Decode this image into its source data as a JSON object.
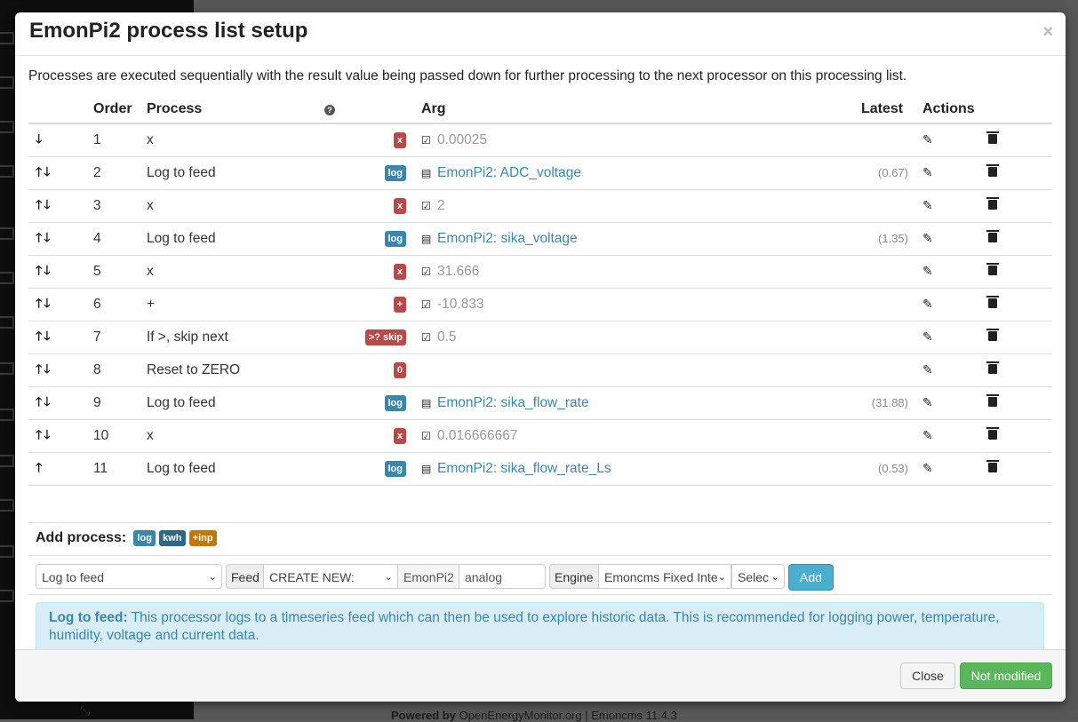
{
  "background": {
    "footer_powered": "Powered by",
    "footer_link": "OpenEnergyMonitor.org",
    "footer_version": "| Emoncms 11.4.3"
  },
  "modal": {
    "title": "EmonPi2 process list setup",
    "close_symbol": "×",
    "intro": "Processes are executed sequentially with the result value being passed down for further processing to the next processor on this processing list.",
    "table": {
      "headers": {
        "order": "Order",
        "process": "Process",
        "help": "?",
        "arg": "Arg",
        "latest": "Latest",
        "actions": "Actions"
      },
      "rows": [
        {
          "arrows": "down",
          "order": "1",
          "process": "x",
          "badge": "x",
          "badge_color": "#b94a48",
          "arg_type": "value",
          "arg": "0.00025",
          "latest": ""
        },
        {
          "arrows": "updown",
          "order": "2",
          "process": "Log to feed",
          "badge": "log",
          "badge_color": "#3a87ad",
          "arg_type": "feed",
          "arg": "EmonPi2: ADC_voltage",
          "latest": "(0.67)"
        },
        {
          "arrows": "updown",
          "order": "3",
          "process": "x",
          "badge": "x",
          "badge_color": "#b94a48",
          "arg_type": "value",
          "arg": "2",
          "latest": ""
        },
        {
          "arrows": "updown",
          "order": "4",
          "process": "Log to feed",
          "badge": "log",
          "badge_color": "#3a87ad",
          "arg_type": "feed",
          "arg": "EmonPi2: sika_voltage",
          "latest": "(1.35)"
        },
        {
          "arrows": "updown",
          "order": "5",
          "process": "x",
          "badge": "x",
          "badge_color": "#b94a48",
          "arg_type": "value",
          "arg": "31.666",
          "latest": ""
        },
        {
          "arrows": "updown",
          "order": "6",
          "process": "+",
          "badge": "+",
          "badge_color": "#b94a48",
          "arg_type": "value",
          "arg": "-10.833",
          "latest": ""
        },
        {
          "arrows": "updown",
          "order": "7",
          "process": "If >, skip next",
          "badge": ">? skip",
          "badge_color": "#b94a48",
          "arg_type": "value",
          "arg": "0.5",
          "latest": ""
        },
        {
          "arrows": "updown",
          "order": "8",
          "process": "Reset to ZERO",
          "badge": "0",
          "badge_color": "#b94a48",
          "arg_type": "none",
          "arg": "",
          "latest": ""
        },
        {
          "arrows": "updown",
          "order": "9",
          "process": "Log to feed",
          "badge": "log",
          "badge_color": "#3a87ad",
          "arg_type": "feed",
          "arg": "EmonPi2: sika_flow_rate",
          "latest": "(31.88)"
        },
        {
          "arrows": "updown",
          "order": "10",
          "process": "x",
          "badge": "x",
          "badge_color": "#b94a48",
          "arg_type": "value",
          "arg": "0.016666667",
          "latest": ""
        },
        {
          "arrows": "up",
          "order": "11",
          "process": "Log to feed",
          "badge": "log",
          "badge_color": "#3a87ad",
          "arg_type": "feed",
          "arg": "EmonPi2: sika_flow_rate_Ls",
          "latest": "(0.53)"
        }
      ]
    },
    "add_process": {
      "label": "Add process:",
      "badges": [
        {
          "text": "log",
          "color": "#3a87ad"
        },
        {
          "text": "kwh",
          "color": "#2d6987"
        },
        {
          "text": "+inp",
          "color": "#c67605"
        }
      ]
    },
    "controls": {
      "process_select": "Log to feed",
      "feed_label": "Feed",
      "feed_select": "CREATE NEW:",
      "tag_input": "EmonPi2",
      "name_input": "analog",
      "engine_label": "Engine",
      "engine_select": "Emoncms Fixed Inte",
      "interval_select": "Selec",
      "add_button": "Add"
    },
    "info": {
      "title": "Log to feed:",
      "text": "This processor logs to a timeseries feed which can then be used to explore historic data. This is recommended for logging power, temperature, humidity, voltage and current data."
    },
    "footer": {
      "close_button": "Close",
      "status_button": "Not modified"
    }
  }
}
